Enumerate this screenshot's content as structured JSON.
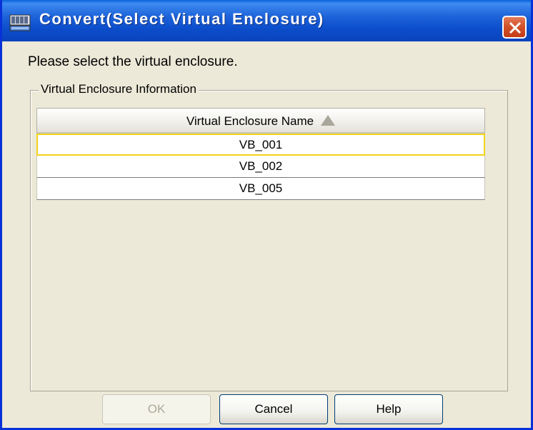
{
  "window": {
    "title": "Convert(Select Virtual Enclosure)",
    "app_icon": "storage-enclosure-icon",
    "close_icon": "close-icon"
  },
  "prompt": "Please select the virtual enclosure.",
  "group": {
    "label": "Virtual Enclosure Information"
  },
  "table": {
    "column_header": "Virtual Enclosure Name",
    "sort_icon": "sort-ascending-icon",
    "rows": [
      "VB_001",
      "VB_002",
      "VB_005"
    ],
    "selected_row": "VB_001"
  },
  "buttons": {
    "ok": "OK",
    "cancel": "Cancel",
    "help": "Help"
  }
}
